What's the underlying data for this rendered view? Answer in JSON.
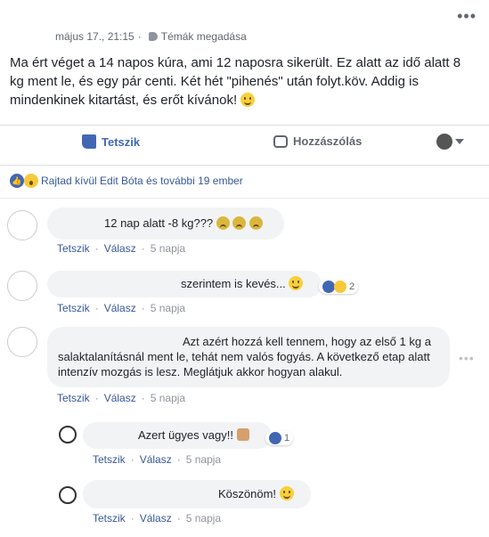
{
  "post": {
    "date": "május 17., 21:15",
    "separator": "·",
    "tag_label": "Témák megadása",
    "text": "Ma ért véget a 14 napos kúra, ami 12 naposra sikerült. Ez alatt az idő alatt 8 kg ment le, és egy pár centi. Két hét \"pihenés\" után folyt.köv. Addig is mindenkinek kitartást, és erőt kívánok!",
    "like_label": "Tetszik",
    "comment_label": "Hozzászólás"
  },
  "reactions": {
    "text": "Rajtad kívül Edit Bóta és további 19 ember"
  },
  "comments": [
    {
      "text": "12 nap alatt -8 kg???",
      "like": "Tetszik",
      "reply": "Válasz",
      "time": "5 napja"
    },
    {
      "text": "szerintem is kevés...",
      "like": "Tetszik",
      "reply": "Válasz",
      "time": "5 napja",
      "reaction_count": "2"
    },
    {
      "text": "Azt azért hozzá kell tennem, hogy az első 1 kg a salaktalanításnál ment le, tehát nem valós fogyás. A következő etap alatt intenzív mozgás is lesz. Meglátjuk akkor hogyan alakul.",
      "like": "Tetszik",
      "reply": "Válasz",
      "time": "5 napja"
    }
  ],
  "replies": [
    {
      "text": "Azert ügyes vagy!!",
      "like": "Tetszik",
      "reply": "Válasz",
      "time": "5 napja",
      "reaction_count": "1"
    },
    {
      "text": "Köszönöm!",
      "like": "Tetszik",
      "reply": "Válasz",
      "time": "5 napja"
    }
  ],
  "icons": [
    "more-options-icon",
    "tag-icon",
    "like-icon",
    "comment-icon",
    "caret-down-icon",
    "smile-icon",
    "sad-icon",
    "wow-icon",
    "haha-icon",
    "thumbs-up-icon"
  ],
  "colors": {
    "link": "#385898",
    "accent": "#4267b2",
    "bubble": "#f2f3f5",
    "muted": "#606770"
  }
}
